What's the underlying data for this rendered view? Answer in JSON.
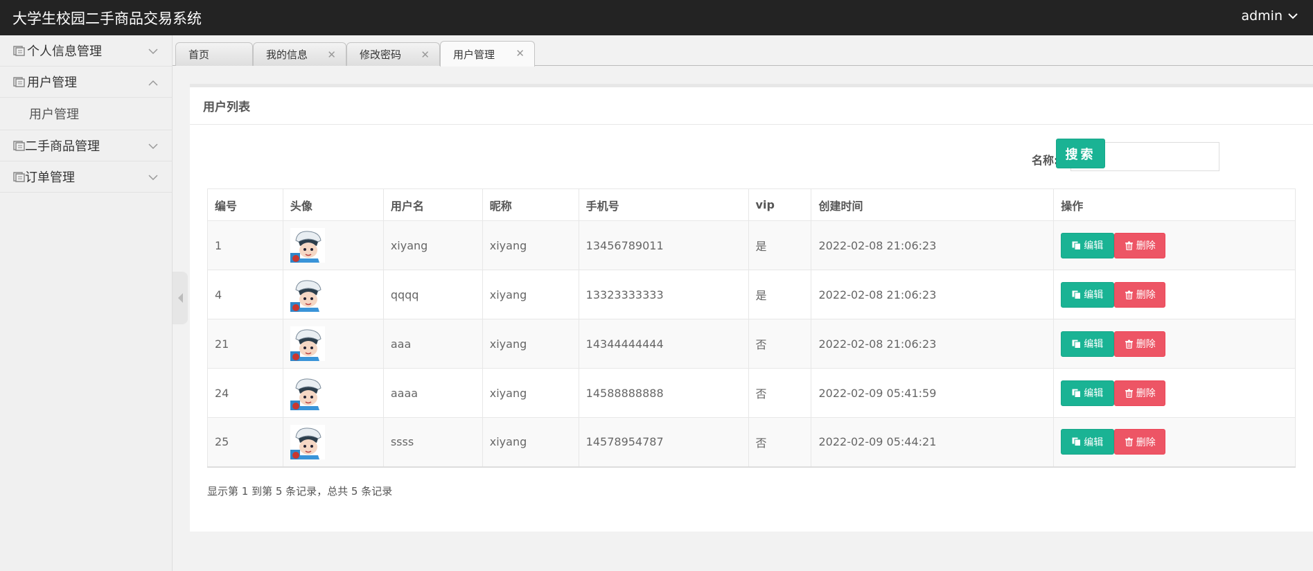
{
  "header": {
    "app_title": "大学生校园二手商品交易系统",
    "user_label": "admin"
  },
  "sidebar": {
    "items": [
      {
        "label": "个人信息管理",
        "expanded": false
      },
      {
        "label": "用户管理",
        "expanded": true,
        "children": [
          "用户管理"
        ]
      },
      {
        "label": "二手商品管理",
        "expanded": false
      },
      {
        "label": "订单管理",
        "expanded": false
      }
    ]
  },
  "tabs": [
    {
      "label": "首页",
      "closable": false
    },
    {
      "label": "我的信息",
      "closable": true
    },
    {
      "label": "修改密码",
      "closable": true
    },
    {
      "label": "用户管理",
      "closable": true,
      "active": true
    }
  ],
  "panel": {
    "title": "用户列表",
    "search_label": "名称:",
    "search_value": "",
    "search_button": "搜索"
  },
  "table": {
    "columns": [
      "编号",
      "头像",
      "用户名",
      "昵称",
      "手机号",
      "vip",
      "创建时间",
      "操作"
    ],
    "rows": [
      {
        "id": "1",
        "username": "xiyang",
        "nickname": "xiyang",
        "phone": "13456789011",
        "vip": "是",
        "created": "2022-02-08 21:06:23"
      },
      {
        "id": "4",
        "username": "qqqq",
        "nickname": "xiyang",
        "phone": "13323333333",
        "vip": "是",
        "created": "2022-02-08 21:06:23"
      },
      {
        "id": "21",
        "username": "aaa",
        "nickname": "xiyang",
        "phone": "14344444444",
        "vip": "否",
        "created": "2022-02-08 21:06:23"
      },
      {
        "id": "24",
        "username": "aaaa",
        "nickname": "xiyang",
        "phone": "14588888888",
        "vip": "否",
        "created": "2022-02-09 05:41:59"
      },
      {
        "id": "25",
        "username": "ssss",
        "nickname": "xiyang",
        "phone": "14578954787",
        "vip": "否",
        "created": "2022-02-09 05:44:21"
      }
    ],
    "edit_label": "编辑",
    "delete_label": "删除"
  },
  "pagination": {
    "summary": "显示第 1 到第 5 条记录，总共 5 条记录"
  },
  "colors": {
    "topbar": "#232323",
    "primary": "#1ab394",
    "danger": "#ed5565"
  },
  "icons": {
    "menu": "book-icon",
    "edit": "copy-icon",
    "delete": "trash-icon",
    "collapse": "chevron-down-icon"
  }
}
